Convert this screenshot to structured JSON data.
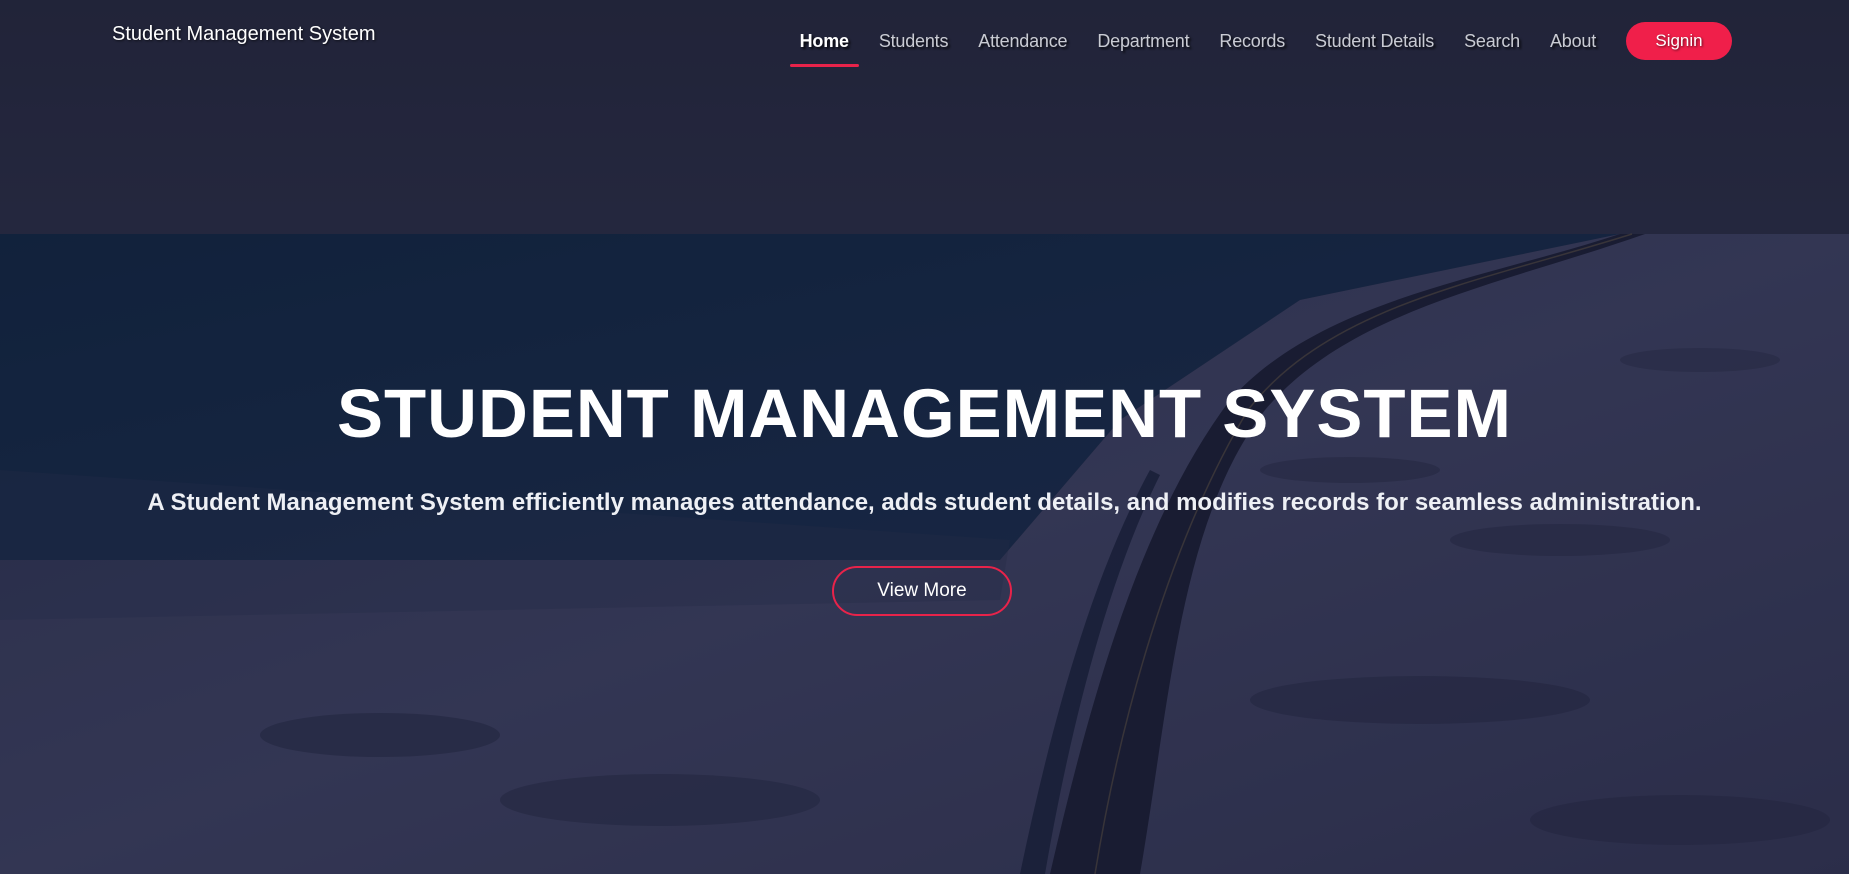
{
  "brand": {
    "title": "Student Management System"
  },
  "nav": {
    "items": [
      {
        "label": "Home",
        "active": true
      },
      {
        "label": "Students",
        "active": false
      },
      {
        "label": "Attendance",
        "active": false
      },
      {
        "label": "Department",
        "active": false
      },
      {
        "label": "Records",
        "active": false
      },
      {
        "label": "Student Details",
        "active": false
      },
      {
        "label": "Search",
        "active": false
      },
      {
        "label": "About",
        "active": false
      }
    ],
    "signin_label": "Signin"
  },
  "hero": {
    "title": "STUDENT MANAGEMENT SYSTEM",
    "description": "A Student Management System efficiently manages attendance, adds student details, and modifies records for seamless administration.",
    "cta_label": "View More"
  },
  "colors": {
    "accent": "#e8234a",
    "signin_bg": "#f01f4a",
    "overlay": "#161830",
    "nav_text": "#c9cbd3"
  }
}
